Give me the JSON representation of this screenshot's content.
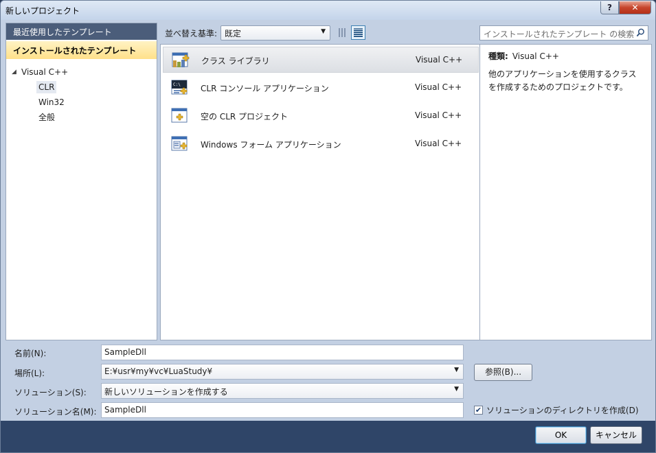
{
  "window": {
    "title": "新しいプロジェクト",
    "help_label": "?",
    "close_label": "✕"
  },
  "left_panel": {
    "recent_label": "最近使用したテンプレート",
    "installed_label": "インストールされたテンプレート",
    "tree": {
      "root": "Visual C++",
      "children": [
        "CLR",
        "Win32",
        "全般"
      ],
      "selected": "CLR"
    }
  },
  "toolbar": {
    "sort_label": "並べ替え基準:",
    "sort_value": "既定",
    "search_placeholder": "インストールされたテンプレート の検索"
  },
  "templates": [
    {
      "name": "クラス ライブラリ",
      "lang": "Visual C++",
      "icon": "class-library-icon"
    },
    {
      "name": "CLR コンソール アプリケーション",
      "lang": "Visual C++",
      "icon": "console-app-icon"
    },
    {
      "name": "空の CLR プロジェクト",
      "lang": "Visual C++",
      "icon": "empty-project-icon"
    },
    {
      "name": "Windows フォーム アプリケーション",
      "lang": "Visual C++",
      "icon": "forms-app-icon"
    }
  ],
  "detail": {
    "type_label": "種類:",
    "type_value": "Visual C++",
    "description": "他のアプリケーションを使用するクラスを作成するためのプロジェクトです。"
  },
  "form": {
    "name_label": "名前(N):",
    "name_value": "SampleDll",
    "location_label": "場所(L):",
    "location_value": "E:¥usr¥my¥vc¥LuaStudy¥",
    "solution_label": "ソリューション(S):",
    "solution_value": "新しいソリューションを作成する",
    "solution_name_label": "ソリューション名(M):",
    "solution_name_value": "SampleDll",
    "browse_label": "参照(B)...",
    "create_dir_label": "ソリューションのディレクトリを作成(D)",
    "create_dir_checked": true
  },
  "buttons": {
    "ok": "OK",
    "cancel": "キャンセル"
  },
  "colors": {
    "selection_highlight": "#ffe08a",
    "panel_header": "#4b5d7a",
    "footer": "#2f4568"
  }
}
